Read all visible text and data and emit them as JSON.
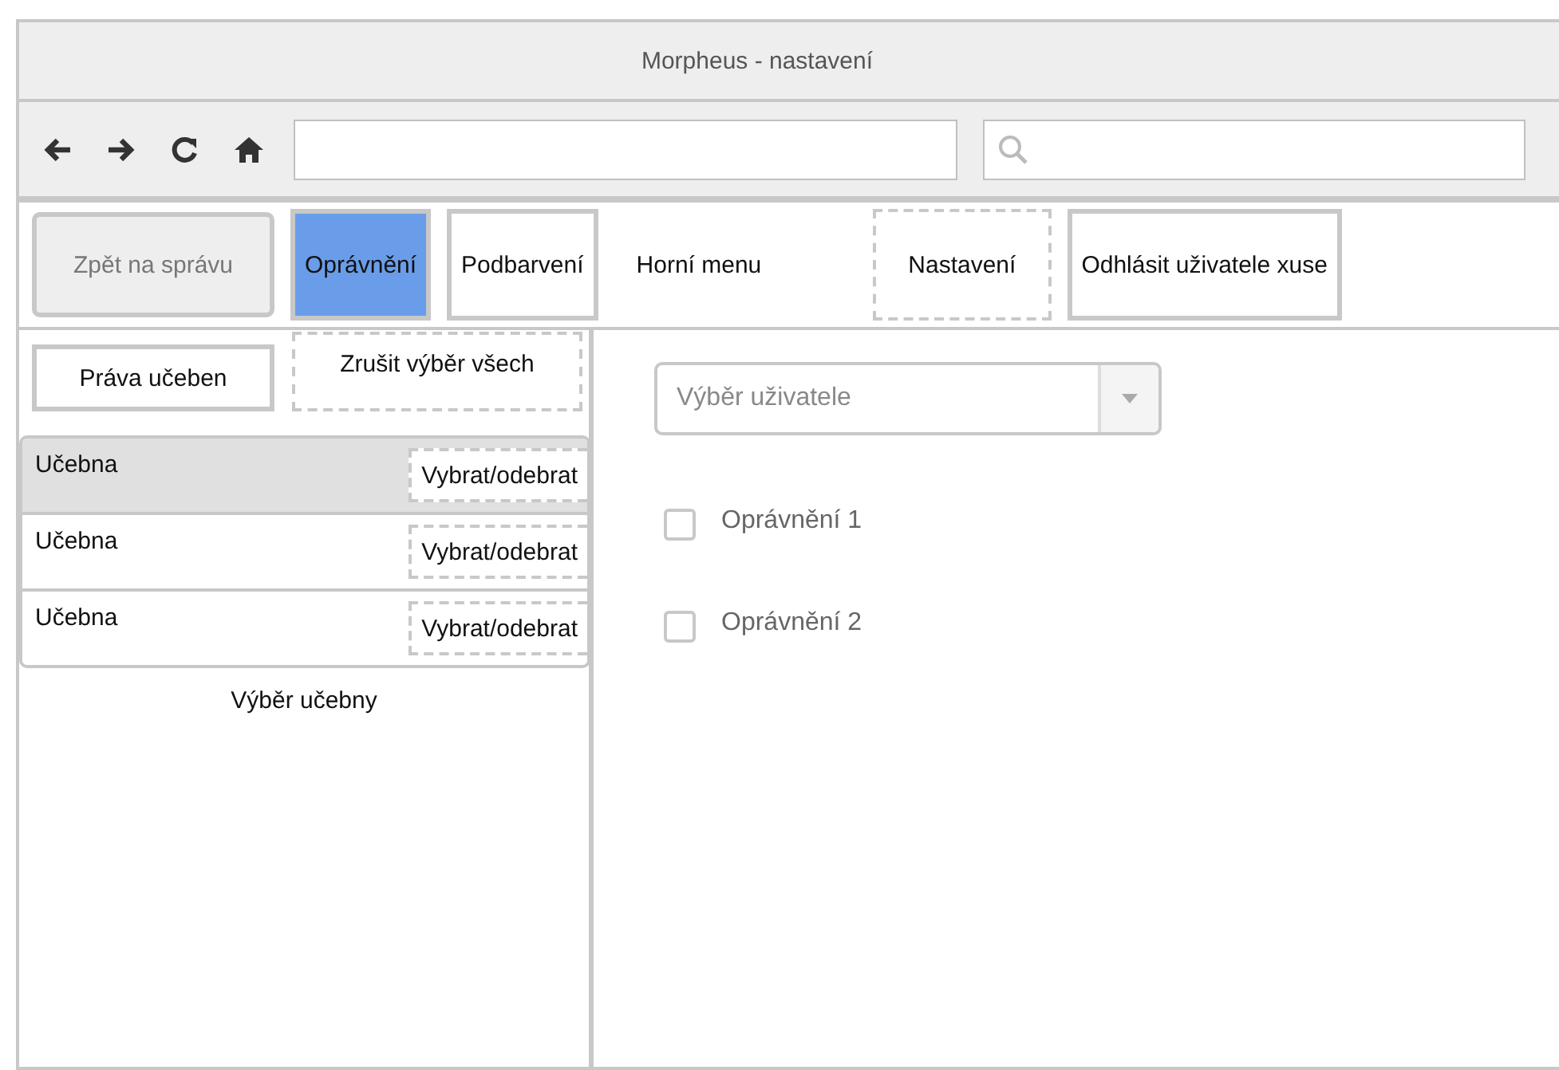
{
  "window": {
    "title": "Morpheus - nastavení"
  },
  "nav": [
    {
      "label": "Zpět na správu",
      "kind": "rounded",
      "selected": false
    },
    {
      "label": "Oprávnění",
      "kind": "solid",
      "selected": true
    },
    {
      "label": "Podbarvení",
      "kind": "solid",
      "selected": false
    },
    {
      "label": "Horní menu",
      "kind": "plain",
      "selected": false
    },
    {
      "label": "Nastavení",
      "kind": "dashed",
      "selected": false
    },
    {
      "label": "Odhlásit uživatele xuse",
      "kind": "solid",
      "selected": false
    }
  ],
  "sidebar": {
    "buttons": [
      {
        "label": "Práva učeben",
        "kind": "solid"
      },
      {
        "label": "Zrušit výběr všech",
        "kind": "dashed"
      }
    ],
    "rooms": [
      {
        "name": "Učebna",
        "action": "Vybrat/odebrat",
        "selected": true
      },
      {
        "name": "Učebna",
        "action": "Vybrat/odebrat",
        "selected": false
      },
      {
        "name": "Učebna",
        "action": "Vybrat/odebrat",
        "selected": false
      }
    ],
    "caption": "Výběr učebny"
  },
  "user_select": {
    "placeholder": "Výběr uživatele"
  },
  "permissions": [
    {
      "label": "Oprávnění 1",
      "checked": false
    },
    {
      "label": "Oprávnění 2",
      "checked": false
    }
  ]
}
